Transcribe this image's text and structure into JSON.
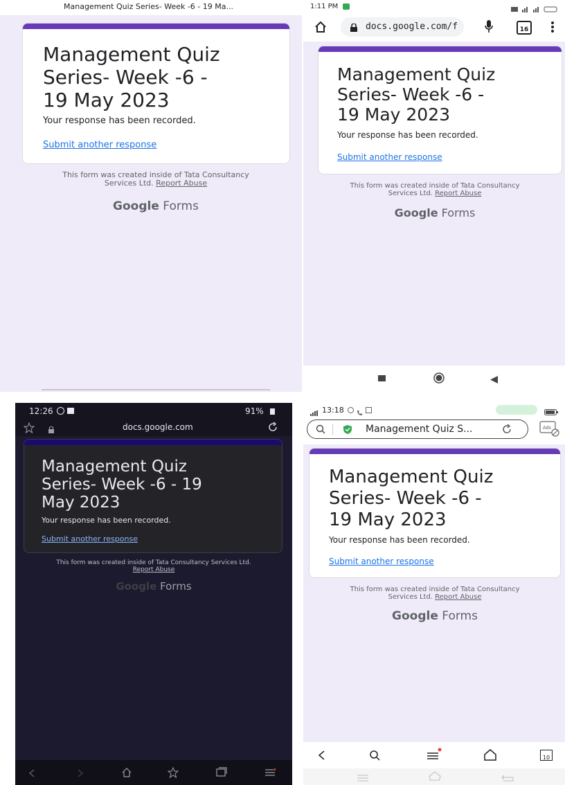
{
  "form": {
    "title": "Management Quiz Series- Week -6 - 19 May 2023",
    "title_line1": "Management Quiz",
    "title_line2": "Series- Week -6 -",
    "title_line3": "19 May 2023",
    "title_dark_line1": "Management Quiz",
    "title_dark_line2": "Series- Week -6 - 19",
    "title_dark_line3": "May 2023",
    "response_text": "Your response has been recorded.",
    "submit_another": "Submit another response",
    "footer_line1": "This form was created inside of Tata Consultancy",
    "footer_line2_prefix": "Services Ltd. ",
    "footer_dark_line1": "This form was created inside of Tata Consultancy Services Ltd.",
    "report_abuse": "Report Abuse",
    "logo_google": "Google",
    "logo_forms": "Forms",
    "accent_color": "#673ab7",
    "link_color": "#1a73e8"
  },
  "panel_top_left": {
    "tab_title": "Management Quiz Series- Week -6 - 19 Ma..."
  },
  "panel_top_right": {
    "time": "1:11 PM",
    "url": "docs.google.com/f",
    "tab_count": "16",
    "icons": [
      "home-icon",
      "lock-icon",
      "mic-icon",
      "tabs-icon",
      "more-icon"
    ],
    "nav_icons": [
      "recents-icon",
      "home-circle-icon",
      "back-icon"
    ]
  },
  "panel_bottom_left": {
    "time": "12:26",
    "battery": "91%",
    "url": "docs.google.com",
    "theme": "dark",
    "icons": [
      "star-icon",
      "lock-icon",
      "reload-icon",
      "back-icon",
      "forward-icon",
      "home-icon",
      "bookmarks-icon",
      "tabs-icon",
      "menu-icon"
    ]
  },
  "panel_bottom_right": {
    "time": "13:18",
    "tab_title": "Management Quiz S...",
    "tab_count": "10",
    "icons": [
      "search-icon",
      "shield-icon",
      "reload-icon",
      "adblock-icon",
      "back-icon",
      "search-icon",
      "menu-icon",
      "home-icon",
      "tabs-icon"
    ]
  }
}
